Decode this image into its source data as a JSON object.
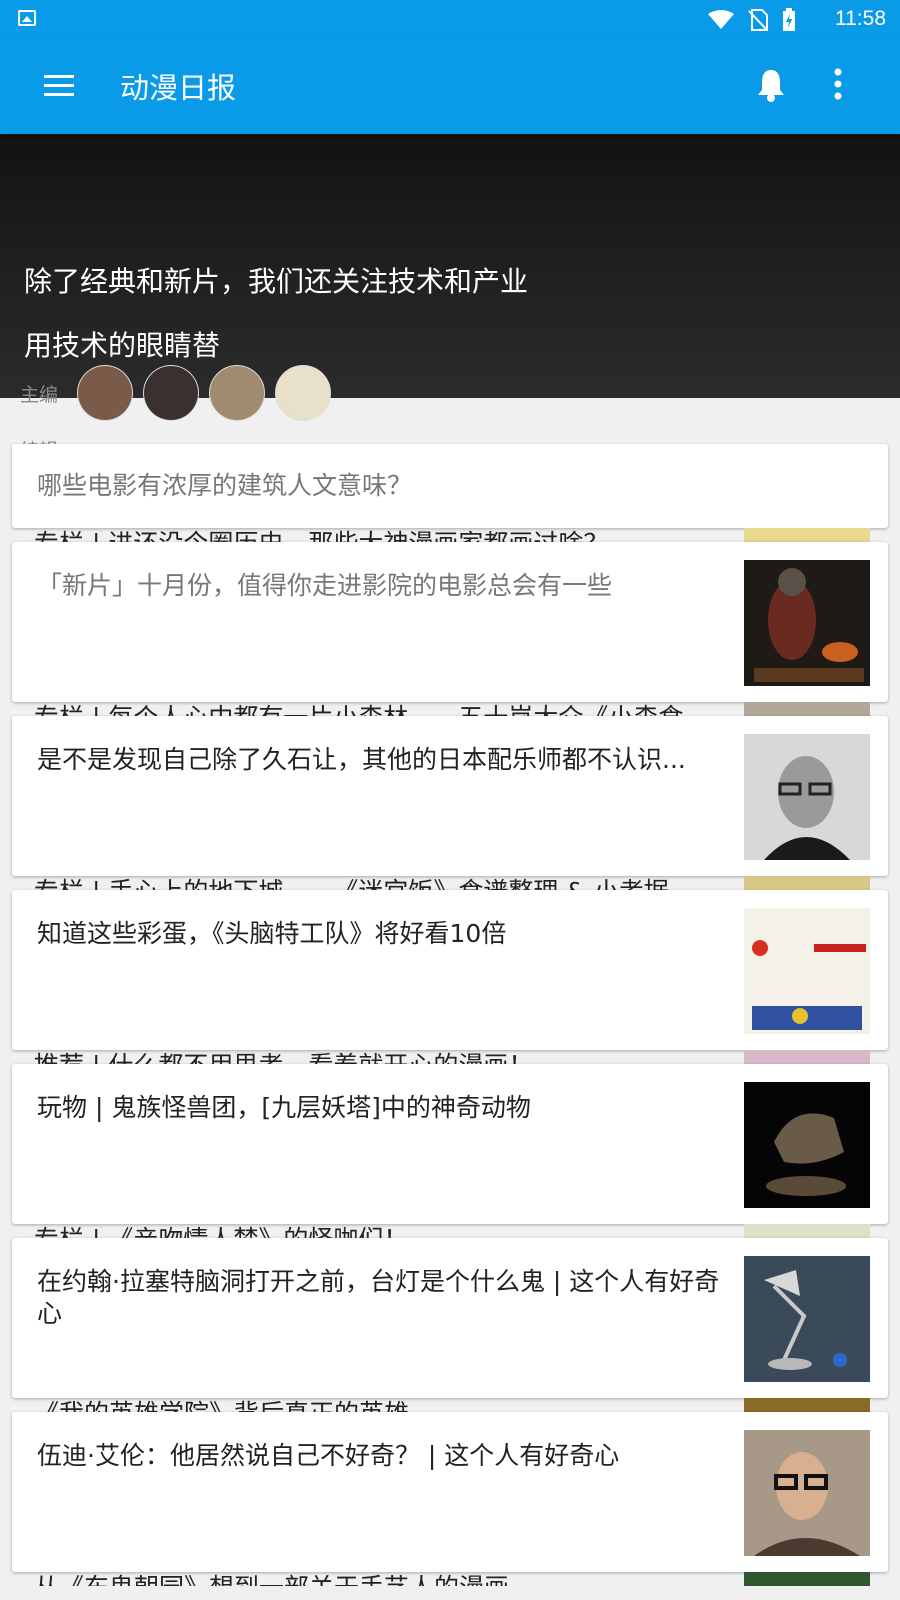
{
  "status_bar": {
    "time": "11:58"
  },
  "app_bar": {
    "title": "动漫日报"
  },
  "hero": {
    "title": "除了经典和新片，我们还关注技术和产业",
    "ghost_title": "用技术的眼睛替"
  },
  "editors": {
    "chief_label": "主编",
    "editor_label": "编辑"
  },
  "cards": [
    {
      "title": "哪些电影有浓厚的建筑人文意味？",
      "read": true
    },
    {
      "title": "「新片」十月份，值得你走进影院的电影总会有一些",
      "read": true,
      "thumb": "ant-man"
    },
    {
      "title": "是不是发现自己除了久石让，其他的日本配乐师都不认识...",
      "read": false,
      "thumb": "portrait-glasses"
    },
    {
      "title": "知道这些彩蛋，《头脑特工队》将好看10倍",
      "read": false,
      "thumb": "tomatometer"
    },
    {
      "title": "玩物 | 鬼族怪兽团，[九层妖塔]中的神奇动物",
      "read": false,
      "thumb": "creature"
    },
    {
      "title": "在约翰·拉塞特脑洞打开之前，台灯是个什么鬼 | 这个人有好奇心",
      "read": false,
      "thumb": "lamp"
    },
    {
      "title": "伍迪·艾伦：他居然说自己不好奇？ |  这个人有好奇心",
      "read": false,
      "thumb": "woody-allen"
    }
  ],
  "peeks": [
    "专栏 | 进还没今圈历史，那些大神漫画家都画过啥？",
    "专栏 | 每个人心中都有一片小森林——五十岚大介《小森食",
    "专栏 | 手心上的地下城——《迷宫饭》食谱整理 & 小考据",
    "推荐 | 什么都不用思考，看着就开心的漫画！",
    "专栏 | 《亲吻情人梦》的怪咖们！",
    "《我的英雄学院》背后真正的英雄",
    "从《东鬼朝园》想到一部关于手艺人的漫画"
  ]
}
